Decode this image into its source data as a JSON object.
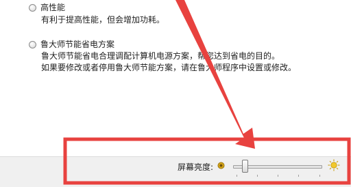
{
  "plans": [
    {
      "name": "高性能",
      "description": [
        "有利于提高性能，但会增加功耗。"
      ]
    },
    {
      "name": "鲁大师节能省电方案",
      "description": [
        "鲁大师节能省电合理调配计算机电源方案，帮您达到省电的目的。",
        "如果要修改或者停用鲁大师节能方案，请在鲁大师程序中设置或修改。"
      ]
    }
  ],
  "brightness": {
    "label": "屏幕亮度:",
    "level_fraction": 0.11,
    "dim_icon": "dim-sun-icon",
    "bright_icon": "bright-sun-icon"
  },
  "colors": {
    "annotation_red": "#e8423f",
    "dim_icon_fill": "#d4a419",
    "bright_icon_fill": "#f2c92b"
  }
}
